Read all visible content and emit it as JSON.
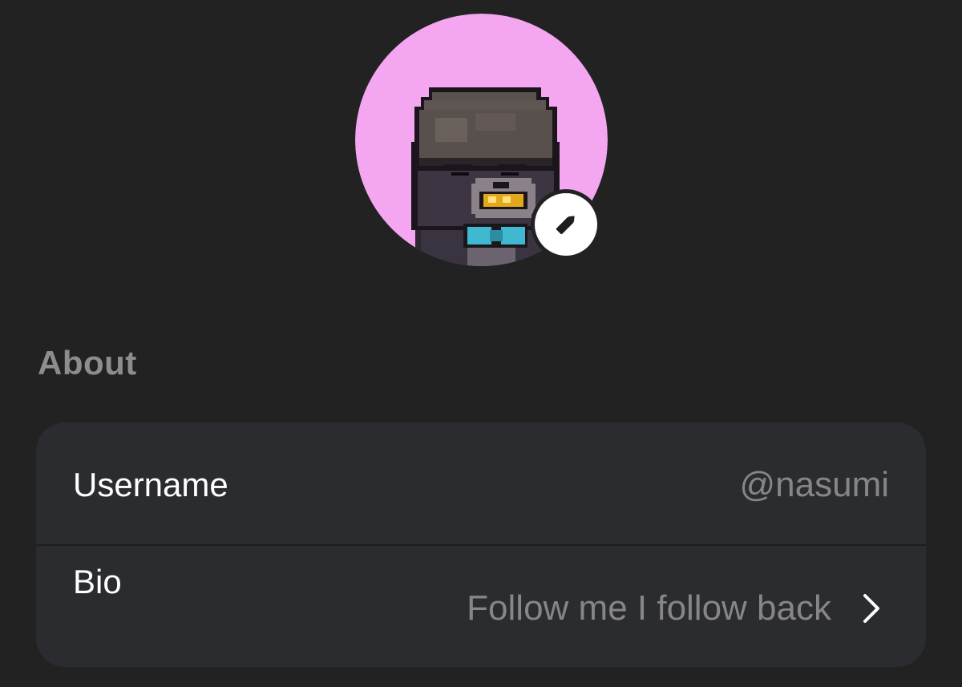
{
  "profile": {
    "avatar_bg_color": "#f4a6f0",
    "edit_icon": "pencil-icon"
  },
  "about": {
    "title": "About",
    "rows": [
      {
        "label": "Username",
        "value": "@nasumi"
      },
      {
        "label": "Bio",
        "value": "Follow me I follow back",
        "icon": "chevron-right-icon"
      }
    ]
  }
}
